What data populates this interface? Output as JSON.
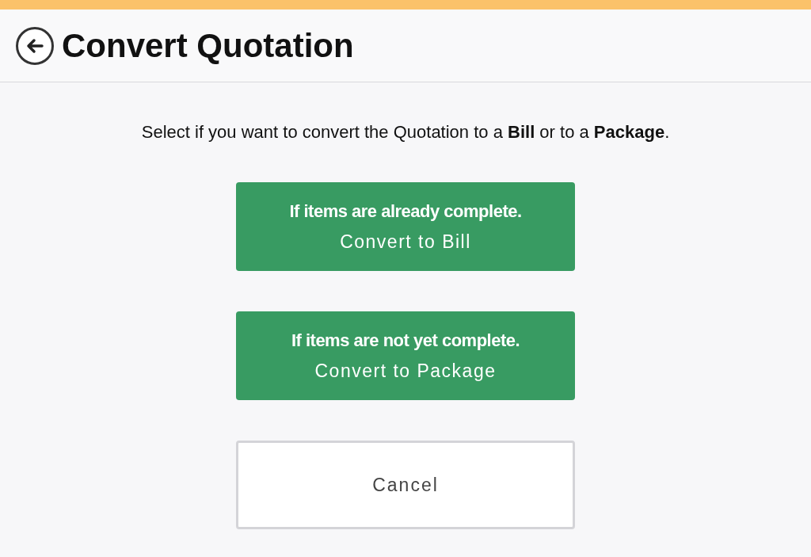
{
  "header": {
    "title": "Convert Quotation"
  },
  "instruction": "Select if you want to convert the Quotation to a **Bill** or to a **Package**.",
  "options": [
    {
      "condition": "If items are already complete.",
      "action": "Convert to Bill"
    },
    {
      "condition": "If items are not yet complete.",
      "action": "Convert to Package"
    }
  ],
  "cancel": "Cancel"
}
